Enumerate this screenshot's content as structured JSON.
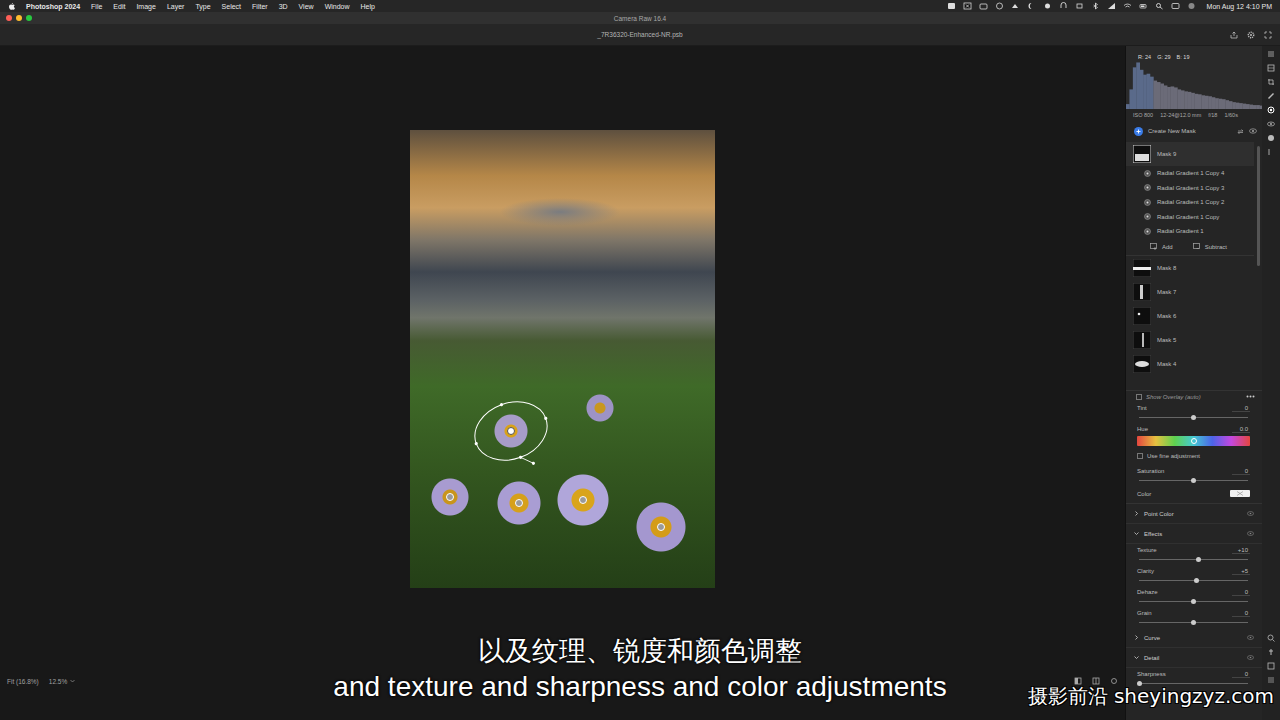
{
  "menubar": {
    "app": "Photoshop 2024",
    "menus": [
      "File",
      "Edit",
      "Image",
      "Layer",
      "Type",
      "Select",
      "Filter",
      "3D",
      "View",
      "Window",
      "Help"
    ],
    "clock": "Mon Aug 12  4:10 PM"
  },
  "window": {
    "title": "Camera Raw 16.4",
    "file": "_7R36320-Enhanced-NR.psb"
  },
  "canvas": {
    "pins": [
      {
        "selected": true
      },
      {
        "selected": false
      },
      {
        "selected": false
      },
      {
        "selected": false
      },
      {
        "selected": false
      }
    ]
  },
  "status_bar": {
    "fit": "Fit (16.8%)",
    "zoom": "12.5%"
  },
  "histogram": {
    "readout": [
      "R: 24",
      "G: 29",
      "B: 19"
    ],
    "values": [
      10,
      40,
      85,
      95,
      80,
      70,
      72,
      66,
      58,
      55,
      52,
      48,
      45,
      46,
      44,
      40,
      38,
      36,
      35,
      33,
      31,
      30,
      28,
      27,
      26,
      24,
      22,
      21,
      20,
      18,
      16,
      14,
      13,
      12,
      11,
      10,
      9,
      8,
      8,
      7
    ]
  },
  "camera_info": [
    "ISO 800",
    "12-24@12.0 mm",
    "f/18",
    "1/60s"
  ],
  "masks": {
    "create": "Create New Mask",
    "items": [
      {
        "name": "Mask 9",
        "selected": true,
        "components": [
          "Radial Gradient 1 Copy 4",
          "Radial Gradient 1 Copy 3",
          "Radial Gradient 1 Copy 2",
          "Radial Gradient 1 Copy",
          "Radial Gradient 1"
        ]
      },
      {
        "name": "Mask 8",
        "selected": false,
        "components": []
      },
      {
        "name": "Mask 7",
        "selected": false,
        "components": []
      },
      {
        "name": "Mask 6",
        "selected": false,
        "components": []
      },
      {
        "name": "Mask 5",
        "selected": false,
        "components": []
      },
      {
        "name": "Mask 4",
        "selected": false,
        "components": []
      }
    ],
    "add": "Add",
    "subtract": "Subtract"
  },
  "overlay": {
    "label": "Show Overlay (auto)",
    "checked": false
  },
  "color_panel": {
    "tint": {
      "label": "Tint",
      "value": "0",
      "level": 0.5
    },
    "hue": {
      "label": "Hue",
      "value": "0.0",
      "level": 0.5
    },
    "fine": {
      "label": "Use fine adjustment",
      "checked": false
    },
    "saturation": {
      "label": "Saturation",
      "value": "0",
      "level": 0.5
    },
    "color": {
      "label": "Color"
    }
  },
  "sections": [
    {
      "label": "Point Color",
      "expanded": false,
      "sliders": []
    },
    {
      "label": "Effects",
      "expanded": true,
      "sliders": [
        {
          "label": "Texture",
          "value": "+10",
          "level": 0.55
        },
        {
          "label": "Clarity",
          "value": "+5",
          "level": 0.525
        },
        {
          "label": "Dehaze",
          "value": "0",
          "level": 0.5
        },
        {
          "label": "Grain",
          "value": "0",
          "level": 0.5
        }
      ]
    },
    {
      "label": "Curve",
      "expanded": false,
      "sliders": []
    },
    {
      "label": "Detail",
      "expanded": true,
      "sliders": [
        {
          "label": "Sharpness",
          "value": "0",
          "level": 0.0
        }
      ]
    }
  ],
  "subtitles": {
    "zh": "以及纹理、锐度和颜色调整",
    "en": "and texture and sharpness and color adjustments"
  },
  "watermark": "摄影前沿 sheyingzyz.com"
}
